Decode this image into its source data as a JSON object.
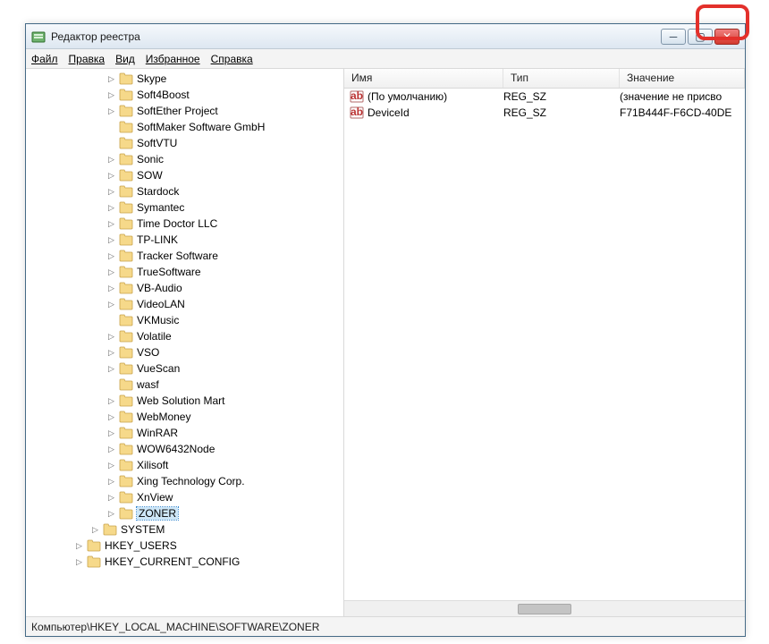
{
  "window": {
    "title": "Редактор реестра"
  },
  "menu": {
    "file": "Файл",
    "edit": "Правка",
    "view": "Вид",
    "favorites": "Избранное",
    "help": "Справка"
  },
  "tree": {
    "items": [
      {
        "label": "Skype",
        "indent": 5,
        "expander": "▷"
      },
      {
        "label": "Soft4Boost",
        "indent": 5,
        "expander": "▷"
      },
      {
        "label": "SoftEther Project",
        "indent": 5,
        "expander": "▷"
      },
      {
        "label": "SoftMaker Software GmbH",
        "indent": 5,
        "expander": ""
      },
      {
        "label": "SoftVTU",
        "indent": 5,
        "expander": ""
      },
      {
        "label": "Sonic",
        "indent": 5,
        "expander": "▷"
      },
      {
        "label": "SOW",
        "indent": 5,
        "expander": "▷"
      },
      {
        "label": "Stardock",
        "indent": 5,
        "expander": "▷"
      },
      {
        "label": "Symantec",
        "indent": 5,
        "expander": "▷"
      },
      {
        "label": "Time Doctor LLC",
        "indent": 5,
        "expander": "▷"
      },
      {
        "label": "TP-LINK",
        "indent": 5,
        "expander": "▷"
      },
      {
        "label": "Tracker Software",
        "indent": 5,
        "expander": "▷"
      },
      {
        "label": "TrueSoftware",
        "indent": 5,
        "expander": "▷"
      },
      {
        "label": "VB-Audio",
        "indent": 5,
        "expander": "▷"
      },
      {
        "label": "VideoLAN",
        "indent": 5,
        "expander": "▷"
      },
      {
        "label": "VKMusic",
        "indent": 5,
        "expander": ""
      },
      {
        "label": "Volatile",
        "indent": 5,
        "expander": "▷"
      },
      {
        "label": "VSO",
        "indent": 5,
        "expander": "▷"
      },
      {
        "label": "VueScan",
        "indent": 5,
        "expander": "▷"
      },
      {
        "label": "wasf",
        "indent": 5,
        "expander": ""
      },
      {
        "label": "Web Solution Mart",
        "indent": 5,
        "expander": "▷"
      },
      {
        "label": "WebMoney",
        "indent": 5,
        "expander": "▷"
      },
      {
        "label": "WinRAR",
        "indent": 5,
        "expander": "▷"
      },
      {
        "label": "WOW6432Node",
        "indent": 5,
        "expander": "▷"
      },
      {
        "label": "Xilisoft",
        "indent": 5,
        "expander": "▷"
      },
      {
        "label": "Xing Technology Corp.",
        "indent": 5,
        "expander": "▷"
      },
      {
        "label": "XnView",
        "indent": 5,
        "expander": "▷"
      },
      {
        "label": "ZONER",
        "indent": 5,
        "expander": "▷",
        "selected": true
      },
      {
        "label": "SYSTEM",
        "indent": 4,
        "expander": "▷"
      },
      {
        "label": "HKEY_USERS",
        "indent": 3,
        "expander": "▷"
      },
      {
        "label": "HKEY_CURRENT_CONFIG",
        "indent": 3,
        "expander": "▷"
      }
    ]
  },
  "list": {
    "columns": {
      "name": "Имя",
      "type": "Тип",
      "value": "Значение"
    },
    "col_widths": {
      "name": 178,
      "type": 130,
      "value": 150
    },
    "rows": [
      {
        "name": "(По умолчанию)",
        "type": "REG_SZ",
        "value": "(значение не присво"
      },
      {
        "name": "DeviceId",
        "type": "REG_SZ",
        "value": "F71B444F-F6CD-40DE"
      }
    ]
  },
  "status": {
    "path": "Компьютер\\HKEY_LOCAL_MACHINE\\SOFTWARE\\ZONER"
  },
  "glyphs": {
    "min": "─",
    "max": "▢",
    "close": "✕"
  }
}
